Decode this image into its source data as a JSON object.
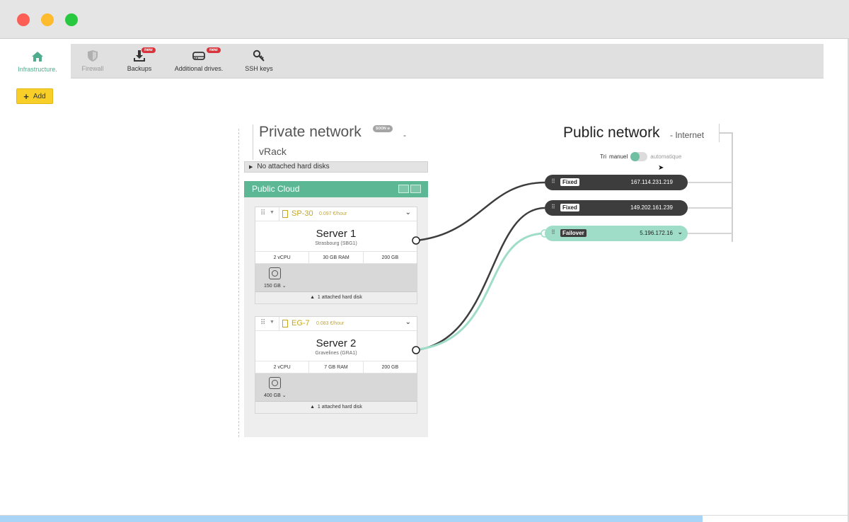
{
  "tabs": [
    {
      "label": "Infrastructure.",
      "icon": "home-icon",
      "active": true
    },
    {
      "label": "Firewall",
      "icon": "shield-icon",
      "disabled": true
    },
    {
      "label": "Backups",
      "icon": "download-icon",
      "badge": "new"
    },
    {
      "label": "Additional drives.",
      "icon": "drive-icon",
      "badge": "new"
    },
    {
      "label": "SSH keys",
      "icon": "key-icon"
    }
  ],
  "add_label": "Add",
  "private_network": {
    "title": "Private network",
    "soon_badge": "SOON ⊖",
    "dash": "-",
    "subtitle": "vRack",
    "no_disks": "No attached hard disks"
  },
  "public_cloud": {
    "title": "Public Cloud",
    "servers": [
      {
        "model": "SP-30",
        "price": "0.097 €/hour",
        "name": "Server 1",
        "location": "Strasbourg (SBG1)",
        "specs": [
          "2 vCPU",
          "30 GB RAM",
          "200 GB"
        ],
        "disk_size": "150 GB",
        "attached": "1 attached hard disk"
      },
      {
        "model": "EG-7",
        "price": "0.083 €/hour",
        "name": "Server 2",
        "location": "Gravelines (GRA1)",
        "specs": [
          "2 vCPU",
          "7 GB RAM",
          "200 GB"
        ],
        "disk_size": "400 GB",
        "attached": "1 attached hard disk"
      }
    ]
  },
  "public_network": {
    "title": "Public network",
    "subtitle": "- Internet",
    "sort_label": "Tri",
    "sort_manual": "manuel",
    "sort_auto": "automatique",
    "ips": [
      {
        "type": "Fixed",
        "address": "167.114.231.219"
      },
      {
        "type": "Fixed",
        "address": "149.202.161.239"
      },
      {
        "type": "Failover",
        "address": "5.196.172.16"
      }
    ]
  },
  "colors": {
    "accent": "#5cb795",
    "add_button": "#f7cf28",
    "ip_dark": "#3d3d3d",
    "ip_failover": "#9fddc8",
    "badge_new": "#d9343c"
  }
}
